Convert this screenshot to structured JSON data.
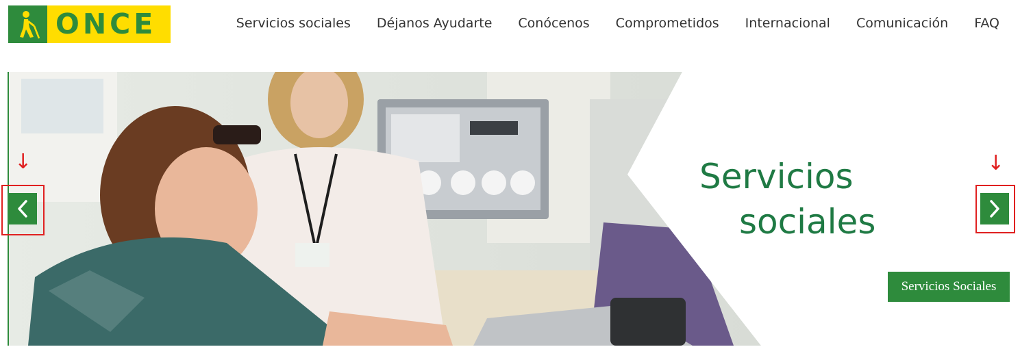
{
  "brand": {
    "name": "ONCE",
    "colors": {
      "green": "#2e8b3c",
      "yellow": "#ffdd00",
      "title_green": "#1f7a44",
      "annotation_red": "#e02020"
    }
  },
  "nav": {
    "items": [
      {
        "label": "Servicios sociales"
      },
      {
        "label": "Déjanos Ayudarte"
      },
      {
        "label": "Conócenos"
      },
      {
        "label": "Comprometidos"
      },
      {
        "label": "Internacional"
      },
      {
        "label": "Comunicación"
      },
      {
        "label": "FAQ"
      }
    ]
  },
  "hero": {
    "title_line1": "Servicios",
    "title_line2": "sociales",
    "cta_label": "Servicios Sociales",
    "prev_icon": "chevron-left-icon",
    "next_icon": "chevron-right-icon",
    "annotation_glyph": "↓"
  }
}
